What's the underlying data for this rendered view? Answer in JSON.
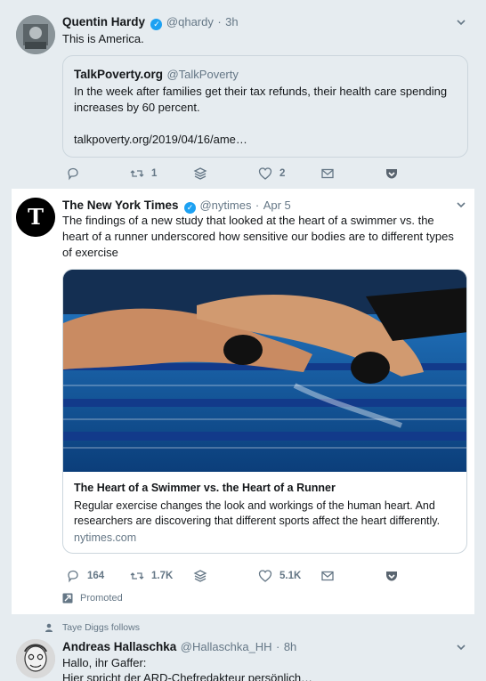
{
  "tweet1": {
    "name": "Quentin Hardy",
    "handle": "@qhardy",
    "time": "3h",
    "text": "This is America.",
    "quote": {
      "name": "TalkPoverty.org",
      "handle": "@TalkPoverty",
      "text": "In the week after families get their tax refunds, their health care spending increases by 60 percent.",
      "link": "talkpoverty.org/2019/04/16/ame…"
    },
    "retweets": "1",
    "likes": "2"
  },
  "tweet2": {
    "name": "The New York Times",
    "handle": "@nytimes",
    "time": "Apr 5",
    "text": "The findings of a new study that looked at the heart of a swimmer vs. the heart of a runner underscored how sensitive our bodies are to different types of exercise",
    "card": {
      "title": "The Heart of a Swimmer vs. the Heart of a Runner",
      "description": "Regular exercise changes the look and workings of the human heart. And researchers are discovering that different sports affect the heart differently.",
      "domain": "nytimes.com"
    },
    "replies": "164",
    "retweets": "1.7K",
    "likes": "5.1K",
    "promoted": "Promoted"
  },
  "tweet3": {
    "context": "Taye Diggs follows",
    "name": "Andreas Hallaschka",
    "handle": "@Hallaschka_HH",
    "time": "8h",
    "text_line1": "Hallo, ihr Gaffer:",
    "text_line2": "Hier spricht der ARD-Chefredakteur persönlich…"
  },
  "colors": {
    "accent": "#1da1f2",
    "background": "#e6ecf0",
    "muted": "#657786",
    "text": "#14171a"
  }
}
